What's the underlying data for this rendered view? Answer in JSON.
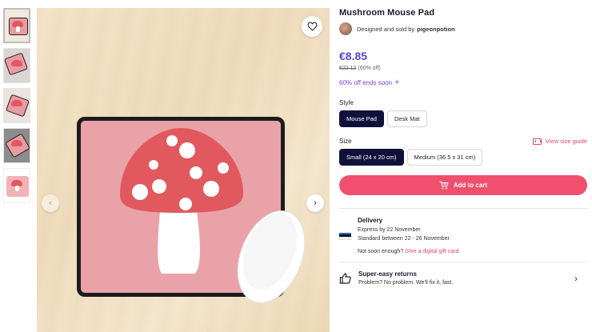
{
  "product": {
    "title": "Mushroom Mouse Pad",
    "designed_by_prefix": "Designed and sold by",
    "seller_name": "pigeonpotion"
  },
  "pricing": {
    "price": "€8.85",
    "old_price": "€22.12",
    "discount": "(60% off)",
    "promo_text": "60% off ends soon"
  },
  "style": {
    "label": "Style",
    "options": [
      "Mouse Pad",
      "Desk Mat"
    ],
    "selected": "Mouse Pad"
  },
  "size": {
    "label": "Size",
    "guide_label": "View size guide",
    "options": [
      "Small (24 x 20 cm)",
      "Medium (36.5 x 31 cm)"
    ],
    "selected": "Small (24 x 20 cm)"
  },
  "cart": {
    "label": "Add to cart"
  },
  "delivery": {
    "title": "Delivery",
    "express": "Express by 22 November",
    "standard": "Standard between 22 - 26 November",
    "gift_prefix": "Not soon enough?",
    "gift_link": "Give a digital gift card."
  },
  "returns": {
    "title": "Super-easy returns",
    "subtitle": "Problem? No problem. We'll fix it, fast."
  },
  "colors": {
    "price": "#5b44d4",
    "cart": "#f0506e",
    "selected_option": "#10103a",
    "link": "#e0486a",
    "pad": "#e9a3a8",
    "mushroom_cap": "#e1585e"
  },
  "icons": {
    "heart": "heart-icon",
    "prev": "chevron-left-icon",
    "next": "chevron-right-icon",
    "cart": "cart-icon",
    "size_guide": "ruler-icon",
    "returns": "thumbs-up-icon",
    "returns_arrow": "chevron-right-icon"
  }
}
